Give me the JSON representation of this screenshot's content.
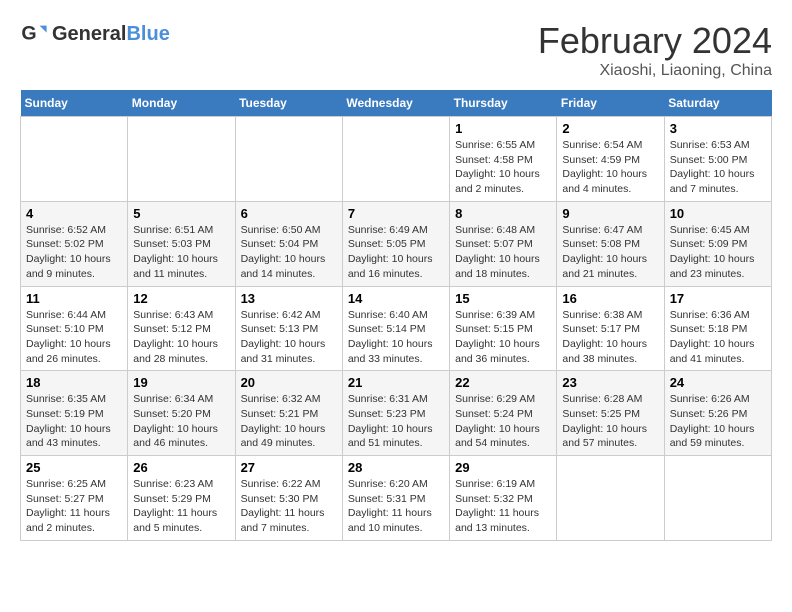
{
  "logo": {
    "text_general": "General",
    "text_blue": "Blue"
  },
  "header": {
    "title": "February 2024",
    "subtitle": "Xiaoshi, Liaoning, China"
  },
  "weekdays": [
    "Sunday",
    "Monday",
    "Tuesday",
    "Wednesday",
    "Thursday",
    "Friday",
    "Saturday"
  ],
  "weeks": [
    [
      {
        "day": "",
        "info": ""
      },
      {
        "day": "",
        "info": ""
      },
      {
        "day": "",
        "info": ""
      },
      {
        "day": "",
        "info": ""
      },
      {
        "day": "1",
        "info": "Sunrise: 6:55 AM\nSunset: 4:58 PM\nDaylight: 10 hours and 2 minutes."
      },
      {
        "day": "2",
        "info": "Sunrise: 6:54 AM\nSunset: 4:59 PM\nDaylight: 10 hours and 4 minutes."
      },
      {
        "day": "3",
        "info": "Sunrise: 6:53 AM\nSunset: 5:00 PM\nDaylight: 10 hours and 7 minutes."
      }
    ],
    [
      {
        "day": "4",
        "info": "Sunrise: 6:52 AM\nSunset: 5:02 PM\nDaylight: 10 hours and 9 minutes."
      },
      {
        "day": "5",
        "info": "Sunrise: 6:51 AM\nSunset: 5:03 PM\nDaylight: 10 hours and 11 minutes."
      },
      {
        "day": "6",
        "info": "Sunrise: 6:50 AM\nSunset: 5:04 PM\nDaylight: 10 hours and 14 minutes."
      },
      {
        "day": "7",
        "info": "Sunrise: 6:49 AM\nSunset: 5:05 PM\nDaylight: 10 hours and 16 minutes."
      },
      {
        "day": "8",
        "info": "Sunrise: 6:48 AM\nSunset: 5:07 PM\nDaylight: 10 hours and 18 minutes."
      },
      {
        "day": "9",
        "info": "Sunrise: 6:47 AM\nSunset: 5:08 PM\nDaylight: 10 hours and 21 minutes."
      },
      {
        "day": "10",
        "info": "Sunrise: 6:45 AM\nSunset: 5:09 PM\nDaylight: 10 hours and 23 minutes."
      }
    ],
    [
      {
        "day": "11",
        "info": "Sunrise: 6:44 AM\nSunset: 5:10 PM\nDaylight: 10 hours and 26 minutes."
      },
      {
        "day": "12",
        "info": "Sunrise: 6:43 AM\nSunset: 5:12 PM\nDaylight: 10 hours and 28 minutes."
      },
      {
        "day": "13",
        "info": "Sunrise: 6:42 AM\nSunset: 5:13 PM\nDaylight: 10 hours and 31 minutes."
      },
      {
        "day": "14",
        "info": "Sunrise: 6:40 AM\nSunset: 5:14 PM\nDaylight: 10 hours and 33 minutes."
      },
      {
        "day": "15",
        "info": "Sunrise: 6:39 AM\nSunset: 5:15 PM\nDaylight: 10 hours and 36 minutes."
      },
      {
        "day": "16",
        "info": "Sunrise: 6:38 AM\nSunset: 5:17 PM\nDaylight: 10 hours and 38 minutes."
      },
      {
        "day": "17",
        "info": "Sunrise: 6:36 AM\nSunset: 5:18 PM\nDaylight: 10 hours and 41 minutes."
      }
    ],
    [
      {
        "day": "18",
        "info": "Sunrise: 6:35 AM\nSunset: 5:19 PM\nDaylight: 10 hours and 43 minutes."
      },
      {
        "day": "19",
        "info": "Sunrise: 6:34 AM\nSunset: 5:20 PM\nDaylight: 10 hours and 46 minutes."
      },
      {
        "day": "20",
        "info": "Sunrise: 6:32 AM\nSunset: 5:21 PM\nDaylight: 10 hours and 49 minutes."
      },
      {
        "day": "21",
        "info": "Sunrise: 6:31 AM\nSunset: 5:23 PM\nDaylight: 10 hours and 51 minutes."
      },
      {
        "day": "22",
        "info": "Sunrise: 6:29 AM\nSunset: 5:24 PM\nDaylight: 10 hours and 54 minutes."
      },
      {
        "day": "23",
        "info": "Sunrise: 6:28 AM\nSunset: 5:25 PM\nDaylight: 10 hours and 57 minutes."
      },
      {
        "day": "24",
        "info": "Sunrise: 6:26 AM\nSunset: 5:26 PM\nDaylight: 10 hours and 59 minutes."
      }
    ],
    [
      {
        "day": "25",
        "info": "Sunrise: 6:25 AM\nSunset: 5:27 PM\nDaylight: 11 hours and 2 minutes."
      },
      {
        "day": "26",
        "info": "Sunrise: 6:23 AM\nSunset: 5:29 PM\nDaylight: 11 hours and 5 minutes."
      },
      {
        "day": "27",
        "info": "Sunrise: 6:22 AM\nSunset: 5:30 PM\nDaylight: 11 hours and 7 minutes."
      },
      {
        "day": "28",
        "info": "Sunrise: 6:20 AM\nSunset: 5:31 PM\nDaylight: 11 hours and 10 minutes."
      },
      {
        "day": "29",
        "info": "Sunrise: 6:19 AM\nSunset: 5:32 PM\nDaylight: 11 hours and 13 minutes."
      },
      {
        "day": "",
        "info": ""
      },
      {
        "day": "",
        "info": ""
      }
    ]
  ]
}
